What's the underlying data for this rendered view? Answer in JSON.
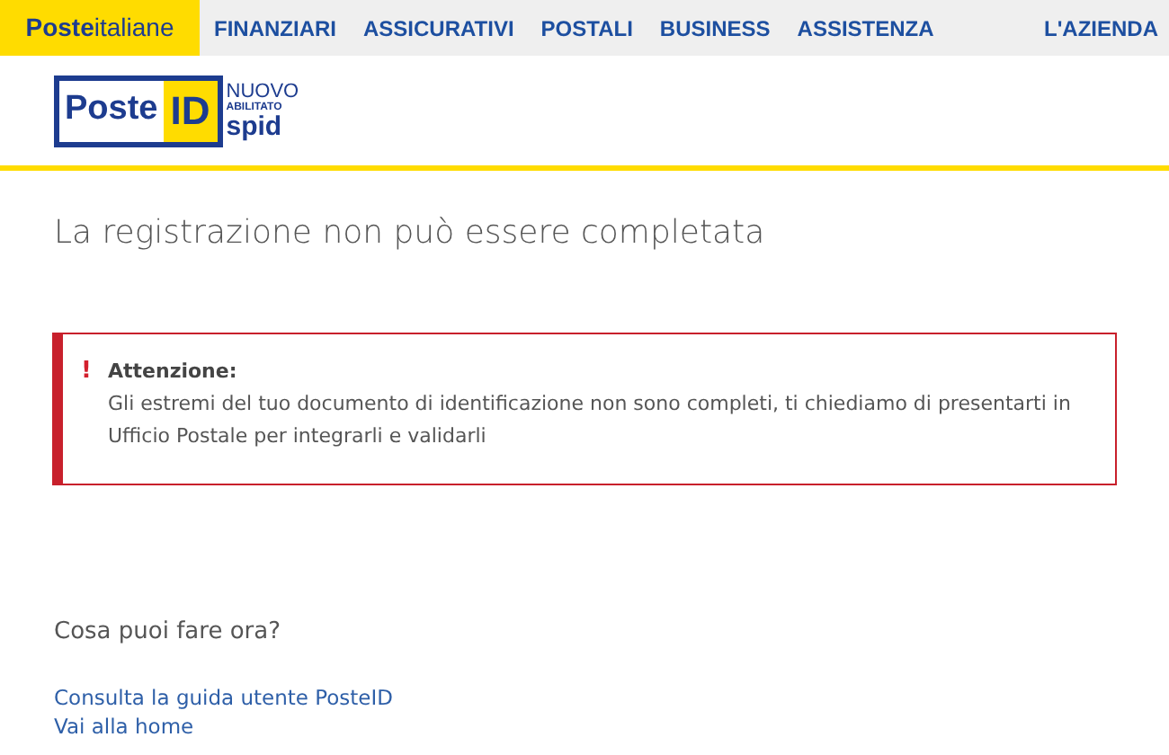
{
  "header": {
    "brand": "**Poste**italiane",
    "nav": [
      {
        "label": "FINANZIARI"
      },
      {
        "label": "ASSICURATIVI"
      },
      {
        "label": "POSTALI"
      },
      {
        "label": "BUSINESS"
      },
      {
        "label": "ASSISTENZA"
      }
    ],
    "nav_right": "L'AZIENDA"
  },
  "logo": {
    "left": "Poste",
    "right": "ID",
    "badge_top": "NUOVO",
    "badge_middle": "ABILITATO",
    "badge_bottom": "spid"
  },
  "title": "La registrazione non può essere completata",
  "alert": {
    "icon": "!",
    "heading": "Attenzione:",
    "message": "Gli estremi del tuo documento di identificazione non sono completi, ti chiediamo di presentarti in Ufficio Postale per integrarli e validarli"
  },
  "next_heading": "Cosa puoi fare ora?",
  "links": [
    "Consulta la guida utente PosteID",
    "Vai alla home"
  ]
}
